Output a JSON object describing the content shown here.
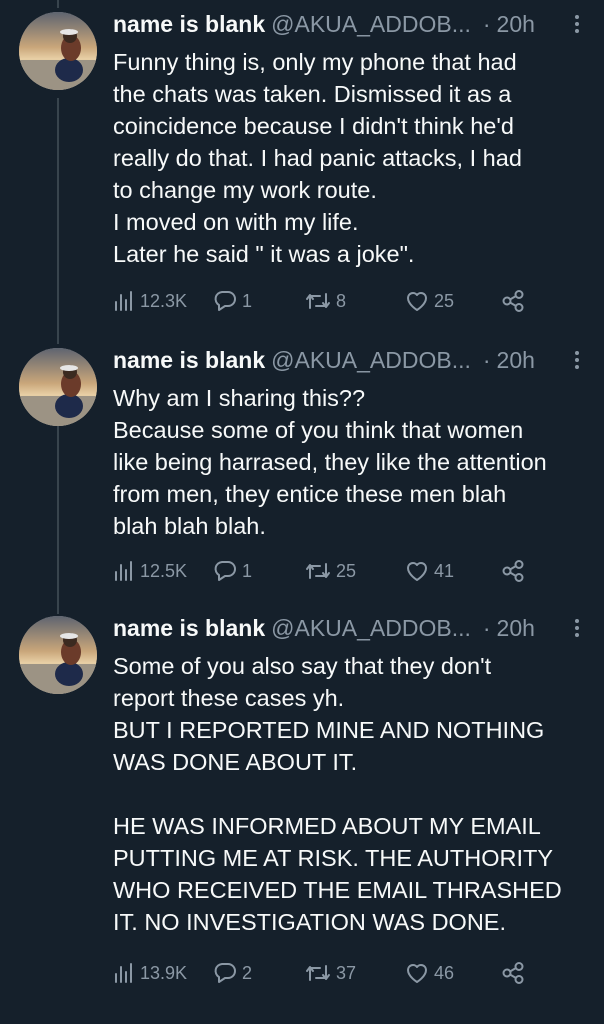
{
  "tweets": [
    {
      "name": "name is blank",
      "handle": "@AKUA_ADDOB...",
      "separator": "·",
      "time": "20h",
      "lines": [
        "Funny thing is, only my phone that had",
        "the chats was taken. Dismissed it as a",
        "coincidence because I didn't think he'd",
        "really do that. I had panic attacks, I had",
        "to change my work route.",
        "I moved on with my life.",
        "Later he said \" it was a joke\"."
      ],
      "views": "12.3K",
      "replies": "1",
      "retweets": "8",
      "likes": "25"
    },
    {
      "name": "name is blank",
      "handle": "@AKUA_ADDOB...",
      "separator": "·",
      "time": "20h",
      "lines": [
        "Why am I sharing this??",
        "Because some of you think that women",
        "like being harrased, they like the attention",
        "from men, they entice these men blah",
        "blah blah blah."
      ],
      "views": "12.5K",
      "replies": "1",
      "retweets": "25",
      "likes": "41"
    },
    {
      "name": "name is blank",
      "handle": "@AKUA_ADDOB...",
      "separator": "·",
      "time": "20h",
      "lines": [
        "Some of you also say that they don't",
        "report these cases yh.",
        "BUT I REPORTED MINE AND NOTHING",
        "WAS DONE ABOUT IT.",
        "",
        "HE WAS INFORMED ABOUT MY EMAIL",
        "PUTTING ME AT RISK. THE AUTHORITY",
        "WHO RECEIVED THE EMAIL THRASHED",
        "IT. NO INVESTIGATION WAS DONE."
      ],
      "views": "13.9K",
      "replies": "2",
      "retweets": "37",
      "likes": "46"
    }
  ],
  "icons": {
    "views": "bar-chart-icon",
    "reply": "speech-bubble-icon",
    "retweet": "retweet-arrows-icon",
    "like": "heart-icon",
    "share": "share-nodes-icon",
    "more": "more-vertical-icon"
  },
  "colors": {
    "background": "#15202b",
    "text": "#f7f9f9",
    "muted": "#8b98a5",
    "thread_line": "#38444d"
  }
}
